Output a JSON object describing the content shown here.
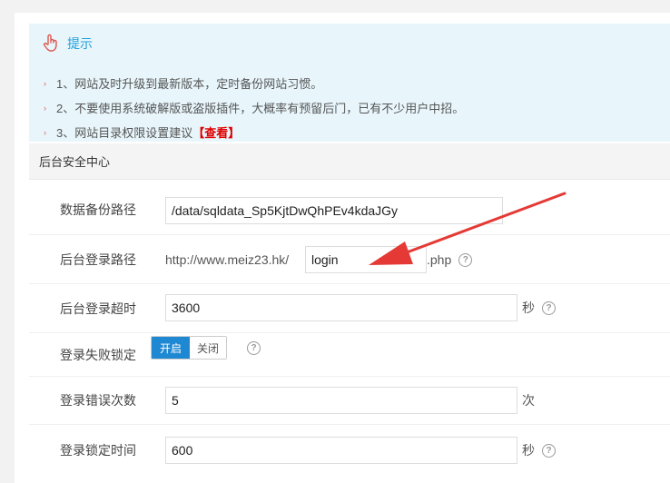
{
  "tips": {
    "title": "提示",
    "items": [
      "1、网站及时升级到最新版本，定时备份网站习惯。",
      "2、不要使用系统破解版或盗版插件，大概率有预留后门，已有不少用户中招。",
      "3、网站目录权限设置建议"
    ],
    "link_label": "【查看】"
  },
  "section": {
    "title": "后台安全中心"
  },
  "form": {
    "backup_path": {
      "label": "数据备份路径",
      "value": "/data/sqldata_Sp5KjtDwQhPEv4kdaJGy"
    },
    "login_path": {
      "label": "后台登录路径",
      "prefix": "http://www.meiz23.hk/",
      "value": "login",
      "suffix": ".php"
    },
    "login_timeout": {
      "label": "后台登录超时",
      "value": "3600",
      "unit": "秒"
    },
    "fail_lock": {
      "label": "登录失败锁定",
      "on_label": "开启",
      "off_label": "关闭",
      "selected": "开启"
    },
    "error_count": {
      "label": "登录错误次数",
      "value": "5",
      "unit": "次"
    },
    "lock_time": {
      "label": "登录锁定时间",
      "value": "600",
      "unit": "秒"
    }
  },
  "colors": {
    "accent": "#1e9fdb",
    "toggle_on": "#1e88d2",
    "warning_link": "#e00000",
    "arrow": "#e53935"
  },
  "icons": {
    "tips": "pointing-hand-icon",
    "help": "question-circle-icon"
  }
}
